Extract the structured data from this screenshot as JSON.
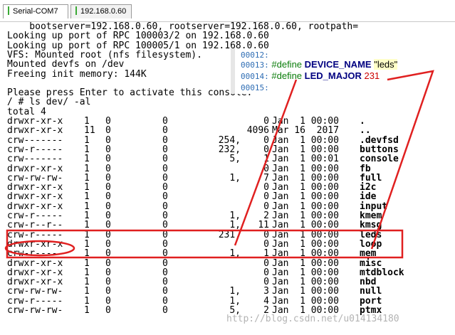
{
  "tabs": [
    {
      "label": "Serial-COM7",
      "active": true
    },
    {
      "label": "192.168.0.60",
      "active": false
    }
  ],
  "boot_lines": [
    "    bootserver=192.168.0.60, rootserver=192.168.0.60, rootpath=",
    "Looking up port of RPC 100003/2 on 192.168.0.60",
    "Looking up port of RPC 100005/1 on 192.168.0.60",
    "VFS: Mounted root (nfs filesystem).",
    "Mounted devfs on /dev",
    "Freeing init memory: 144K",
    "",
    "Please press Enter to activate this console.",
    "/ # ls dev/ -al",
    "total 4"
  ],
  "listing": [
    {
      "perm": "drwxr-xr-x",
      "links": "1",
      "uid": "0",
      "gid": "0",
      "major": "",
      "minor": "0",
      "date": "Jan  1 00:00",
      "name": "."
    },
    {
      "perm": "drwxr-xr-x",
      "links": "11",
      "uid": "0",
      "gid": "0",
      "major": "",
      "minor": "4096",
      "date": "Mar 16  2017",
      "name": ".."
    },
    {
      "perm": "crw-------",
      "links": "1",
      "uid": "0",
      "gid": "0",
      "major": "254,",
      "minor": "0",
      "date": "Jan  1 00:00",
      "name": ".devfsd"
    },
    {
      "perm": "crw-r-----",
      "links": "1",
      "uid": "0",
      "gid": "0",
      "major": "232,",
      "minor": "0",
      "date": "Jan  1 00:00",
      "name": "buttons"
    },
    {
      "perm": "crw-------",
      "links": "1",
      "uid": "0",
      "gid": "0",
      "major": "5,",
      "minor": "1",
      "date": "Jan  1 00:01",
      "name": "console"
    },
    {
      "perm": "drwxr-xr-x",
      "links": "1",
      "uid": "0",
      "gid": "0",
      "major": "",
      "minor": "0",
      "date": "Jan  1 00:00",
      "name": "fb"
    },
    {
      "perm": "crw-rw-rw-",
      "links": "1",
      "uid": "0",
      "gid": "0",
      "major": "1,",
      "minor": "7",
      "date": "Jan  1 00:00",
      "name": "full"
    },
    {
      "perm": "drwxr-xr-x",
      "links": "1",
      "uid": "0",
      "gid": "0",
      "major": "",
      "minor": "0",
      "date": "Jan  1 00:00",
      "name": "i2c"
    },
    {
      "perm": "drwxr-xr-x",
      "links": "1",
      "uid": "0",
      "gid": "0",
      "major": "",
      "minor": "0",
      "date": "Jan  1 00:00",
      "name": "ide"
    },
    {
      "perm": "drwxr-xr-x",
      "links": "1",
      "uid": "0",
      "gid": "0",
      "major": "",
      "minor": "0",
      "date": "Jan  1 00:00",
      "name": "input"
    },
    {
      "perm": "crw-r-----",
      "links": "1",
      "uid": "0",
      "gid": "0",
      "major": "1,",
      "minor": "2",
      "date": "Jan  1 00:00",
      "name": "kmem"
    },
    {
      "perm": "crw-r--r--",
      "links": "1",
      "uid": "0",
      "gid": "0",
      "major": "1,",
      "minor": "11",
      "date": "Jan  1 00:00",
      "name": "kmsg"
    },
    {
      "perm": "crw-r-----",
      "links": "1",
      "uid": "0",
      "gid": "0",
      "major": "231,",
      "minor": "0",
      "date": "Jan  1 00:00",
      "name": "leds"
    },
    {
      "perm": "drwxr-xr-x",
      "links": "1",
      "uid": "0",
      "gid": "0",
      "major": "",
      "minor": "0",
      "date": "Jan  1 00:00",
      "name": "loop"
    },
    {
      "perm": "crw-r-----",
      "links": "1",
      "uid": "0",
      "gid": "0",
      "major": "1,",
      "minor": "1",
      "date": "Jan  1 00:00",
      "name": "mem"
    },
    {
      "perm": "drwxr-xr-x",
      "links": "1",
      "uid": "0",
      "gid": "0",
      "major": "",
      "minor": "0",
      "date": "Jan  1 00:00",
      "name": "misc"
    },
    {
      "perm": "drwxr-xr-x",
      "links": "1",
      "uid": "0",
      "gid": "0",
      "major": "",
      "minor": "0",
      "date": "Jan  1 00:00",
      "name": "mtdblock"
    },
    {
      "perm": "drwxr-xr-x",
      "links": "1",
      "uid": "0",
      "gid": "0",
      "major": "",
      "minor": "0",
      "date": "Jan  1 00:00",
      "name": "nbd"
    },
    {
      "perm": "crw-rw-rw-",
      "links": "1",
      "uid": "0",
      "gid": "0",
      "major": "1,",
      "minor": "3",
      "date": "Jan  1 00:00",
      "name": "null"
    },
    {
      "perm": "crw-r-----",
      "links": "1",
      "uid": "0",
      "gid": "0",
      "major": "1,",
      "minor": "4",
      "date": "Jan  1 00:00",
      "name": "port"
    },
    {
      "perm": "crw-rw-rw-",
      "links": "1",
      "uid": "0",
      "gid": "0",
      "major": "5,",
      "minor": "2",
      "date": "Jan  1 00:00",
      "name": "ptmx"
    }
  ],
  "code_snippet": {
    "lines": [
      {
        "num": "00012:",
        "directive": "",
        "name": "",
        "value": ""
      },
      {
        "num": "00013:",
        "directive": "#define",
        "name": "DEVICE_NAME",
        "value": "\"leds\""
      },
      {
        "num": "00014:",
        "directive": "#define",
        "name": "LED_MAJOR",
        "value": "231"
      },
      {
        "num": "00015:",
        "directive": "",
        "name": "",
        "value": ""
      }
    ]
  },
  "watermark": "http://blog.csdn.net/u014134180",
  "colors": {
    "annotation": "#e02020",
    "define_keyword": "#000080",
    "directive": "#0b7d0b",
    "line_number": "#2e6db4",
    "major_value": "#cc0000"
  }
}
